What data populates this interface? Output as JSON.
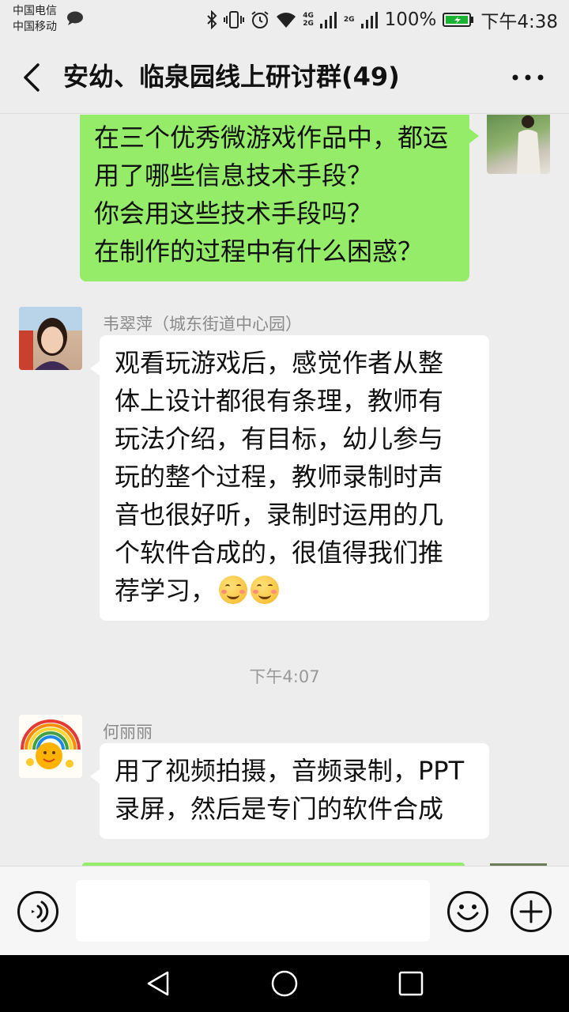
{
  "status_bar": {
    "carrier_1": "中国电信",
    "carrier_2": "中国移动",
    "net_1_top": "4G",
    "net_1_bottom": "2G",
    "net_2": "2G",
    "battery": "100%",
    "time": "下午4:38",
    "icons": [
      "message-icon",
      "bluetooth-icon",
      "vibrate-icon",
      "alarm-icon",
      "wifi-icon",
      "signal-icon",
      "battery-icon"
    ]
  },
  "header": {
    "title": "安幼、临泉园线上研讨群(49)",
    "back_icon": "chevron-left-icon",
    "more_icon": "more-dots-icon"
  },
  "messages": [
    {
      "type": "sent",
      "lines": [
        "在三个优秀微游戏作品中，都运",
        "用了哪些信息技术手段？",
        "你会用这些技术手段吗？",
        "在制作的过程中有什么困惑？"
      ]
    },
    {
      "type": "received",
      "sender": "韦翠萍（城东街道中心园）",
      "lines": [
        "观看玩游戏后，感觉作者从整",
        "体上设计都很有条理，教师有",
        "玩法介绍，有目标，幼儿参与",
        "玩的整个过程，教师录制时声",
        "音也很好听，录制时运用的几",
        "个软件合成的，很值得我们推",
        "荐学习，"
      ],
      "emojis": [
        "blush-smile-emoji",
        "blush-smile-emoji"
      ]
    },
    {
      "type": "time",
      "text": "下午4:07"
    },
    {
      "type": "received",
      "sender": "何丽丽",
      "lines": [
        "用了视频拍摄，音频录制，PPT",
        "录屏，然后是专门的软件合成"
      ]
    }
  ],
  "input_bar": {
    "value": "",
    "icons": [
      "voice-icon",
      "emoji-face-icon",
      "plus-icon"
    ]
  },
  "nav_bar": {
    "icons": [
      "back-triangle-icon",
      "home-circle-icon",
      "recents-square-icon"
    ]
  },
  "colors": {
    "background": "#ededed",
    "sent_bubble": "#95ec69",
    "received_bubble": "#ffffff",
    "nav_bar": "#000000"
  }
}
